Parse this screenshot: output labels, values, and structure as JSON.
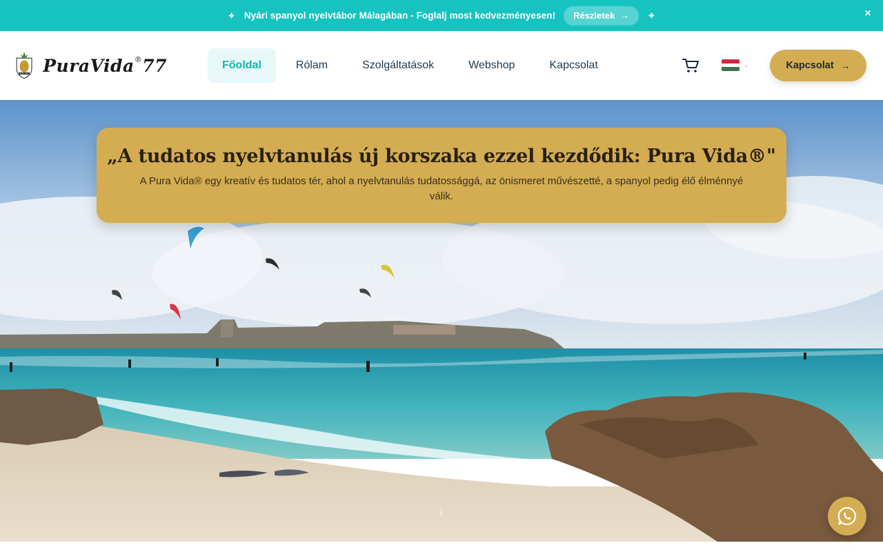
{
  "announcement": {
    "message": "Nyári spanyol nyelvtábor Málagában - Foglalj most kedvezményesen!",
    "button_label": "Részletek",
    "sparkle_icon": "sparkle-icon",
    "close_icon": "close-icon"
  },
  "header": {
    "logo_text": "PuraVida",
    "logo_mark": "®",
    "logo_number": "77",
    "logo_badge_text": "PURA VIDA",
    "nav": [
      {
        "label": "Főoldal",
        "active": true
      },
      {
        "label": "Rólam",
        "active": false
      },
      {
        "label": "Szolgáltatások",
        "active": false
      },
      {
        "label": "Webshop",
        "active": false
      },
      {
        "label": "Kapcsolat",
        "active": false
      }
    ],
    "cart_icon": "cart-icon",
    "language": {
      "flag_colors": [
        "#cd2a3e",
        "#ffffff",
        "#436f4d"
      ],
      "flag": "hungary-flag-icon"
    },
    "cta_label": "Kapcsolat"
  },
  "hero": {
    "title": "„A tudatos nyelvtanulás új korszaka ezzel kezdődik: Pura Vida®\"",
    "subtitle": "A Pura Vida® egy kreatív és tudatos tér, ahol a nyelvtanulás tudatossággá, az önismeret művészetté, a spanyol pedig élő élménnyé válik."
  },
  "colors": {
    "accent_teal": "#17c3c0",
    "gold": "#d4ad52",
    "nav_active_bg": "#e8f8f8"
  },
  "floating": {
    "whatsapp_icon": "whatsapp-icon",
    "scroll_icon": "arrow-down-icon"
  }
}
